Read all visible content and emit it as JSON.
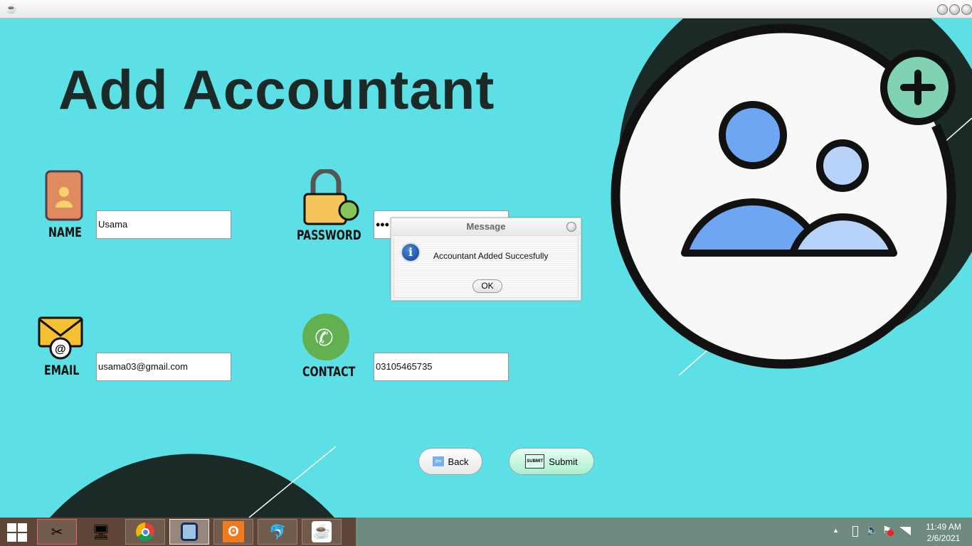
{
  "window": {
    "title": ""
  },
  "page": {
    "title": "Add Accountant"
  },
  "form": {
    "name": {
      "label": "NAME",
      "value": "Usama"
    },
    "password": {
      "label": "PASSWORD",
      "value": "•••"
    },
    "email": {
      "label": "EMAIL",
      "value": "usama03@gmail.com"
    },
    "contact": {
      "label": "CONTACT",
      "value": "03105465735"
    }
  },
  "buttons": {
    "back": "Back",
    "submit": "Submit",
    "submit_icon_text": "SUBMIT"
  },
  "dialog": {
    "title": "Message",
    "message": "Accountant Added Succesfully",
    "ok": "OK"
  },
  "taskbar": {
    "time": "11:49 AM",
    "date": "2/6/2021",
    "apps": [
      "snipping-tool",
      "computer",
      "chrome",
      "virtualbox",
      "xampp",
      "mysql-workbench",
      "java"
    ]
  },
  "colors": {
    "background": "#5ce0e6",
    "dark": "#1c2a27"
  }
}
